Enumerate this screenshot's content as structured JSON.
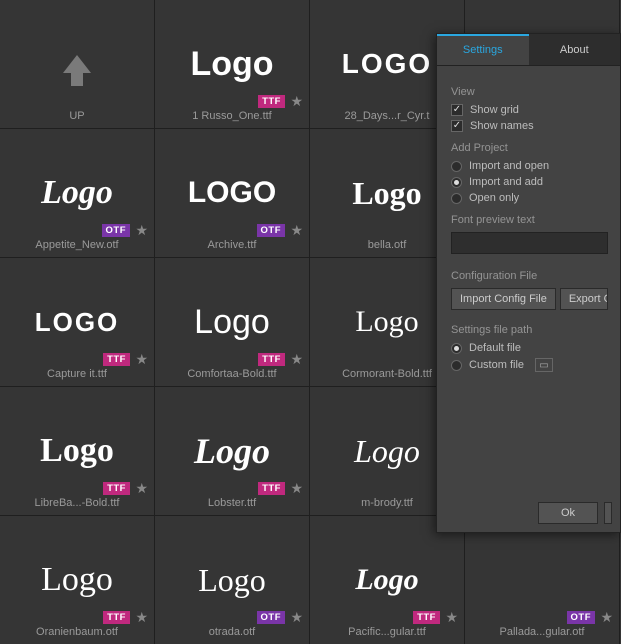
{
  "grid": [
    {
      "label": "UP",
      "style": "arrow",
      "badge": null
    },
    {
      "label": "1 Russo_One.ttf",
      "style": "logo-black-bold",
      "badge": "TTF"
    },
    {
      "label": "28_Days...r_Cyr.t",
      "style": "logo-stencil",
      "badge": null
    },
    {
      "label": "",
      "style": "hidden",
      "badge": null
    },
    {
      "label": "Appetite_New.otf",
      "style": "logo-script-thick",
      "badge": "OTF"
    },
    {
      "label": "Archive.ttf",
      "style": "logo-blocky",
      "badge": "OTF"
    },
    {
      "label": "bella.otf",
      "style": "logo-serif-slab",
      "badge": null
    },
    {
      "label": "",
      "style": "hidden",
      "badge": null
    },
    {
      "label": "Capture it.ttf",
      "style": "logo-stencil2",
      "badge": "TTF"
    },
    {
      "label": "Comfortaa-Bold.ttf",
      "style": "logo-round",
      "badge": "TTF"
    },
    {
      "label": "Cormorant-Bold.ttf",
      "style": "logo-serif-thin",
      "badge": null
    },
    {
      "label": "",
      "style": "hidden",
      "badge": null
    },
    {
      "label": "LibreBa...-Bold.ttf",
      "style": "logo-serif-bold",
      "badge": "TTF"
    },
    {
      "label": "Lobster.ttf",
      "style": "logo-script-cursive",
      "badge": "TTF"
    },
    {
      "label": "m-brody.ttf",
      "style": "logo-script-italic",
      "badge": null
    },
    {
      "label": "",
      "style": "hidden",
      "badge": null
    },
    {
      "label": "Oranienbaum.otf",
      "style": "logo-serif-elegant",
      "badge": "TTF"
    },
    {
      "label": "otrada.otf",
      "style": "logo-serif-med",
      "badge": "OTF"
    },
    {
      "label": "Pacific...gular.ttf",
      "style": "logo-brush",
      "badge": "TTF"
    },
    {
      "label": "Pallada...gular.otf",
      "style": "hidden",
      "badge": "OTF"
    }
  ],
  "logo_text": "Logo",
  "panel": {
    "tabs": {
      "settings": "Settings",
      "about": "About"
    },
    "view": {
      "heading": "View",
      "show_grid": "Show grid",
      "show_names": "Show names"
    },
    "add_project": {
      "heading": "Add Project",
      "opt1": "Import and open",
      "opt2": "Import and add",
      "opt3": "Open only"
    },
    "preview": {
      "heading": "Font preview text"
    },
    "config": {
      "heading": "Configuration File",
      "import_btn": "Import Config File",
      "export_btn": "Export Co"
    },
    "settings_path": {
      "heading": "Settings file path",
      "default": "Default file",
      "custom": "Custom file"
    },
    "ok": "Ok"
  }
}
